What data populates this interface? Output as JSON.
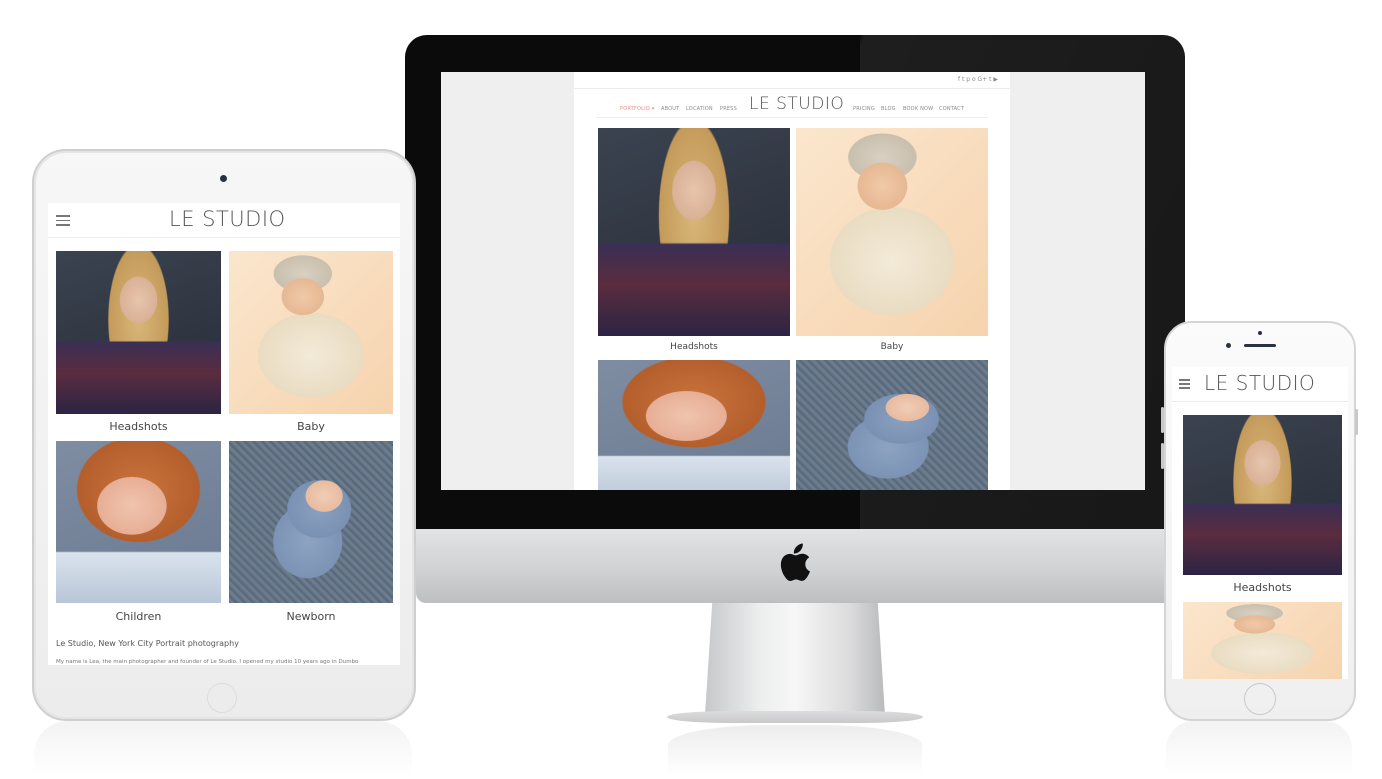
{
  "brand": {
    "logo": "LE STUDIO"
  },
  "desktop": {
    "nav_left": [
      {
        "label": "PORTFOLIO ▾",
        "active": true
      },
      {
        "label": "ABOUT",
        "active": false
      },
      {
        "label": "LOCATION",
        "active": false
      },
      {
        "label": "PRESS",
        "active": false
      }
    ],
    "nav_right": [
      {
        "label": "PRICING"
      },
      {
        "label": "BLOG"
      },
      {
        "label": "BOOK NOW"
      },
      {
        "label": "CONTACT"
      }
    ],
    "social_icons": [
      "facebook-icon",
      "twitter-icon",
      "pinterest-icon",
      "instagram-icon",
      "google-plus-icon",
      "tumblr-icon",
      "youtube-icon"
    ],
    "social_glyphs": "f  t  p  o  G+  t  ▶"
  },
  "gallery": [
    {
      "caption": "Headshots"
    },
    {
      "caption": "Baby"
    },
    {
      "caption": "Children"
    },
    {
      "caption": "Newborn"
    }
  ],
  "tablet": {
    "intro_heading": "Le Studio, New York City Portrait photography",
    "intro_text": "My name is Lea, the main photographer and founder of Le Studio. I opened my studio 10 years ago in Dumbo"
  },
  "device_brand_icon": "apple-logo-icon",
  "colors": {
    "active_nav": "#e48f88",
    "imac_bezel": "#0b0b0b",
    "screen_bg": "#efefef"
  }
}
